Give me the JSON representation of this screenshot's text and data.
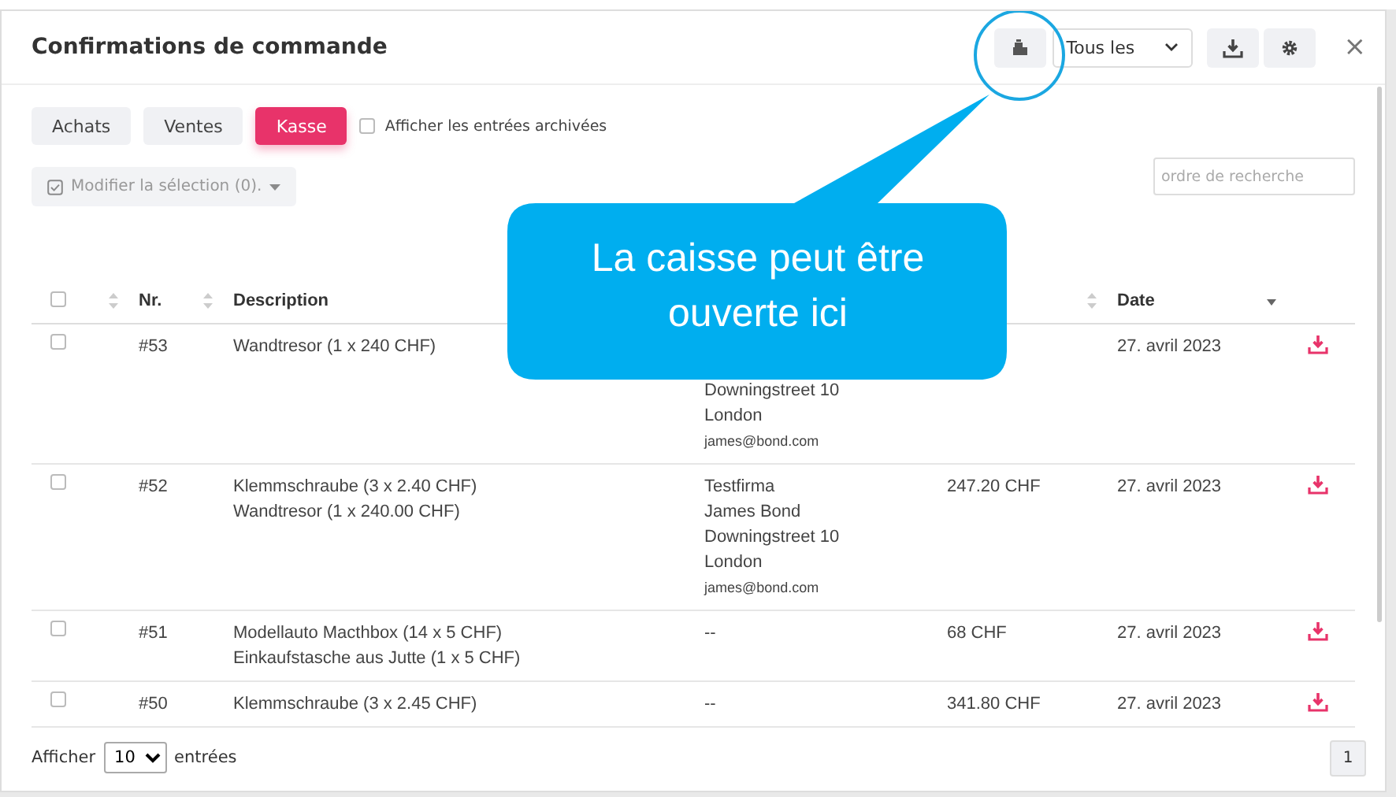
{
  "window": {
    "title": "Confirmations de commande",
    "close": "×"
  },
  "toolbar": {
    "filter_select": {
      "value": "Tous les"
    }
  },
  "tabs": [
    {
      "label": "Achats",
      "selected": false
    },
    {
      "label": "Ventes",
      "selected": false
    },
    {
      "label": "Kasse",
      "selected": true
    }
  ],
  "archived_toggle": {
    "label": "Afficher les entrées archivées",
    "checked": false
  },
  "bulk_button": {
    "label": "Modifier la sélection (0).",
    "disabled": true
  },
  "search": {
    "placeholder": "ordre de recherche"
  },
  "table": {
    "select_all_checked": false,
    "columns": [
      {
        "sorted": false
      },
      {
        "label": "Nr.",
        "sorted": false
      },
      {
        "label": "Description"
      },
      {
        "sorted": false
      },
      {
        "label": "Date",
        "sorted": true
      }
    ],
    "rows": [
      {
        "checked": false,
        "nr": "#53",
        "description": [
          "Wandtresor (1 x 240 CHF)"
        ],
        "customer": [
          "Downingstreet 10",
          "London",
          "james@bond.com"
        ],
        "date": "27. avril 2023"
      },
      {
        "checked": false,
        "nr": "#52",
        "description": [
          "Klemmschraube (3 x 2.40 CHF)",
          "Wandtresor (1 x 240.00 CHF)"
        ],
        "customer": [
          "Testfirma",
          "James Bond",
          "Downingstreet 10",
          "London",
          "james@bond.com"
        ],
        "amount": "247.20 CHF",
        "date": "27. avril 2023"
      },
      {
        "checked": false,
        "nr": "#51",
        "description": [
          "Modellauto Macthbox (14 x 5 CHF)",
          "Einkaufstasche aus Jutte (1 x 5 CHF)"
        ],
        "customer": [
          "--"
        ],
        "amount": "68 CHF",
        "date": "27. avril 2023"
      },
      {
        "checked": false,
        "nr": "#50",
        "description": [
          "Klemmschraube (3 x 2.45 CHF)"
        ],
        "customer": [
          "--"
        ],
        "amount": "341.80 CHF",
        "date": "27. avril 2023"
      }
    ]
  },
  "footer": {
    "show_label": "Afficher",
    "page_size": "10",
    "entries_label": "entrées",
    "pages": [
      {
        "label": "1",
        "selected": true
      }
    ]
  },
  "callout": {
    "text": "La caisse peut être ouverte ici"
  }
}
